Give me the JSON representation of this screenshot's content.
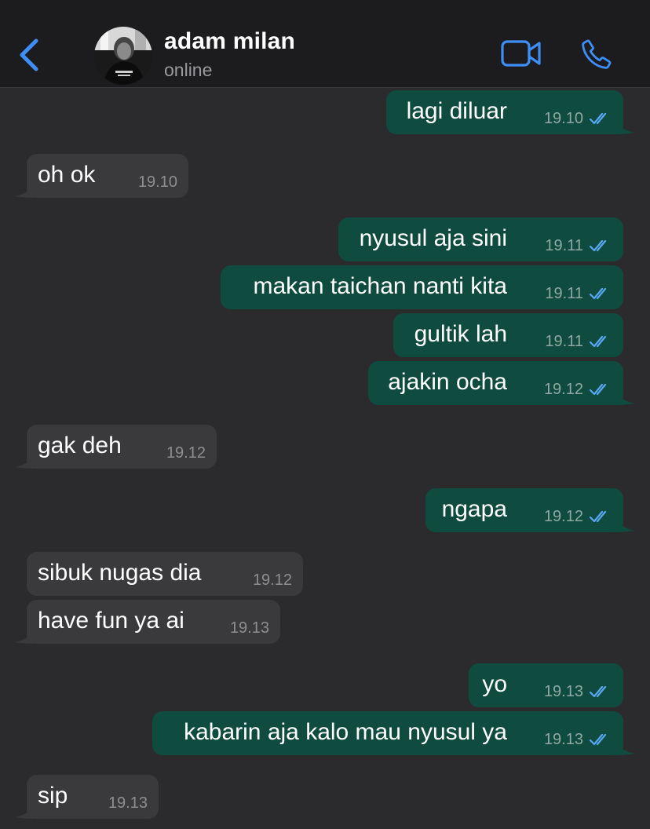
{
  "header": {
    "contact_name": "adam milan",
    "status": "online",
    "back_icon": "chevron-left-icon",
    "video_icon": "video-camera-icon",
    "call_icon": "phone-icon",
    "accent_color": "#3d8ef7"
  },
  "colors": {
    "outgoing_bubble": "#0f4c3f",
    "incoming_bubble": "#3a3a3c",
    "read_ticks": "#5aa8f5"
  },
  "messages": [
    {
      "direction": "out",
      "text": "lagi diluar",
      "time": "19.10",
      "read": true
    },
    {
      "direction": "in",
      "text": "oh ok",
      "time": "19.10"
    },
    {
      "direction": "out",
      "text": "nyusul aja sini",
      "time": "19.11",
      "read": true
    },
    {
      "direction": "out",
      "text": "makan taichan nanti kita",
      "time": "19.11",
      "read": true
    },
    {
      "direction": "out",
      "text": "gultik lah",
      "time": "19.11",
      "read": true
    },
    {
      "direction": "out",
      "text": "ajakin ocha",
      "time": "19.12",
      "read": true
    },
    {
      "direction": "in",
      "text": "gak deh",
      "time": "19.12"
    },
    {
      "direction": "out",
      "text": "ngapa",
      "time": "19.12",
      "read": true
    },
    {
      "direction": "in",
      "text": "sibuk nugas dia",
      "time": "19.12"
    },
    {
      "direction": "in",
      "text": "have fun ya ai",
      "time": "19.13"
    },
    {
      "direction": "out",
      "text": "yo",
      "time": "19.13",
      "read": true
    },
    {
      "direction": "out",
      "text": "kabarin aja kalo mau nyusul ya",
      "time": "19.13",
      "read": true
    },
    {
      "direction": "in",
      "text": "sip",
      "time": "19.13"
    }
  ]
}
